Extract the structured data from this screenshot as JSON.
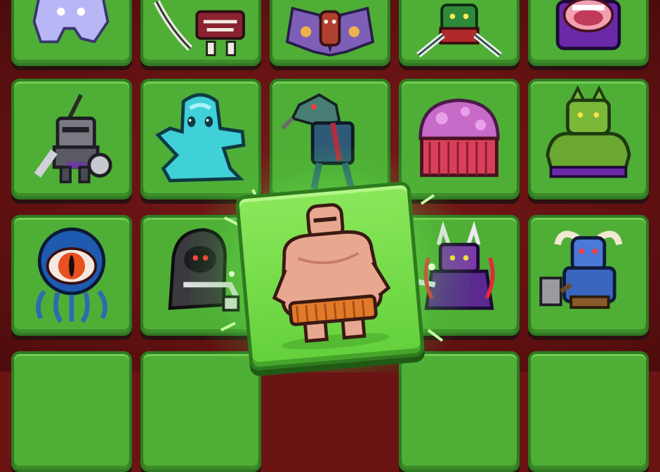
{
  "game": {
    "screen": "monster-collection-grid",
    "selected_monster": "sumo-brute",
    "columns": 5,
    "colors": {
      "background": "#6b1414",
      "tile": "#4fae36",
      "tile_border": "#2f7a22",
      "selected_tile": "#63d03c",
      "glow": "#aaff78"
    }
  },
  "monsters": [
    {
      "row": 1,
      "col": 1,
      "icon": "ice-golem-icon"
    },
    {
      "row": 1,
      "col": 2,
      "icon": "scythe-skeleton-icon"
    },
    {
      "row": 1,
      "col": 3,
      "icon": "moth-beast-icon"
    },
    {
      "row": 1,
      "col": 4,
      "icon": "goblin-blades-icon"
    },
    {
      "row": 1,
      "col": 5,
      "icon": "screaming-mouth-icon"
    },
    {
      "row": 2,
      "col": 1,
      "icon": "armored-knight-icon"
    },
    {
      "row": 2,
      "col": 2,
      "icon": "cyan-ghost-icon"
    },
    {
      "row": 2,
      "col": 3,
      "icon": "bird-warrior-icon"
    },
    {
      "row": 2,
      "col": 4,
      "icon": "jellyfish-icon"
    },
    {
      "row": 2,
      "col": 5,
      "icon": "green-ogre-icon"
    },
    {
      "row": 3,
      "col": 1,
      "icon": "tentacle-eye-icon"
    },
    {
      "row": 3,
      "col": 2,
      "icon": "hooded-reaper-icon"
    },
    {
      "row": 3,
      "col": 3,
      "icon": "sumo-brute-icon",
      "selected": true
    },
    {
      "row": 3,
      "col": 4,
      "icon": "horned-demon-icon"
    },
    {
      "row": 3,
      "col": 5,
      "icon": "minotaur-icon"
    }
  ]
}
